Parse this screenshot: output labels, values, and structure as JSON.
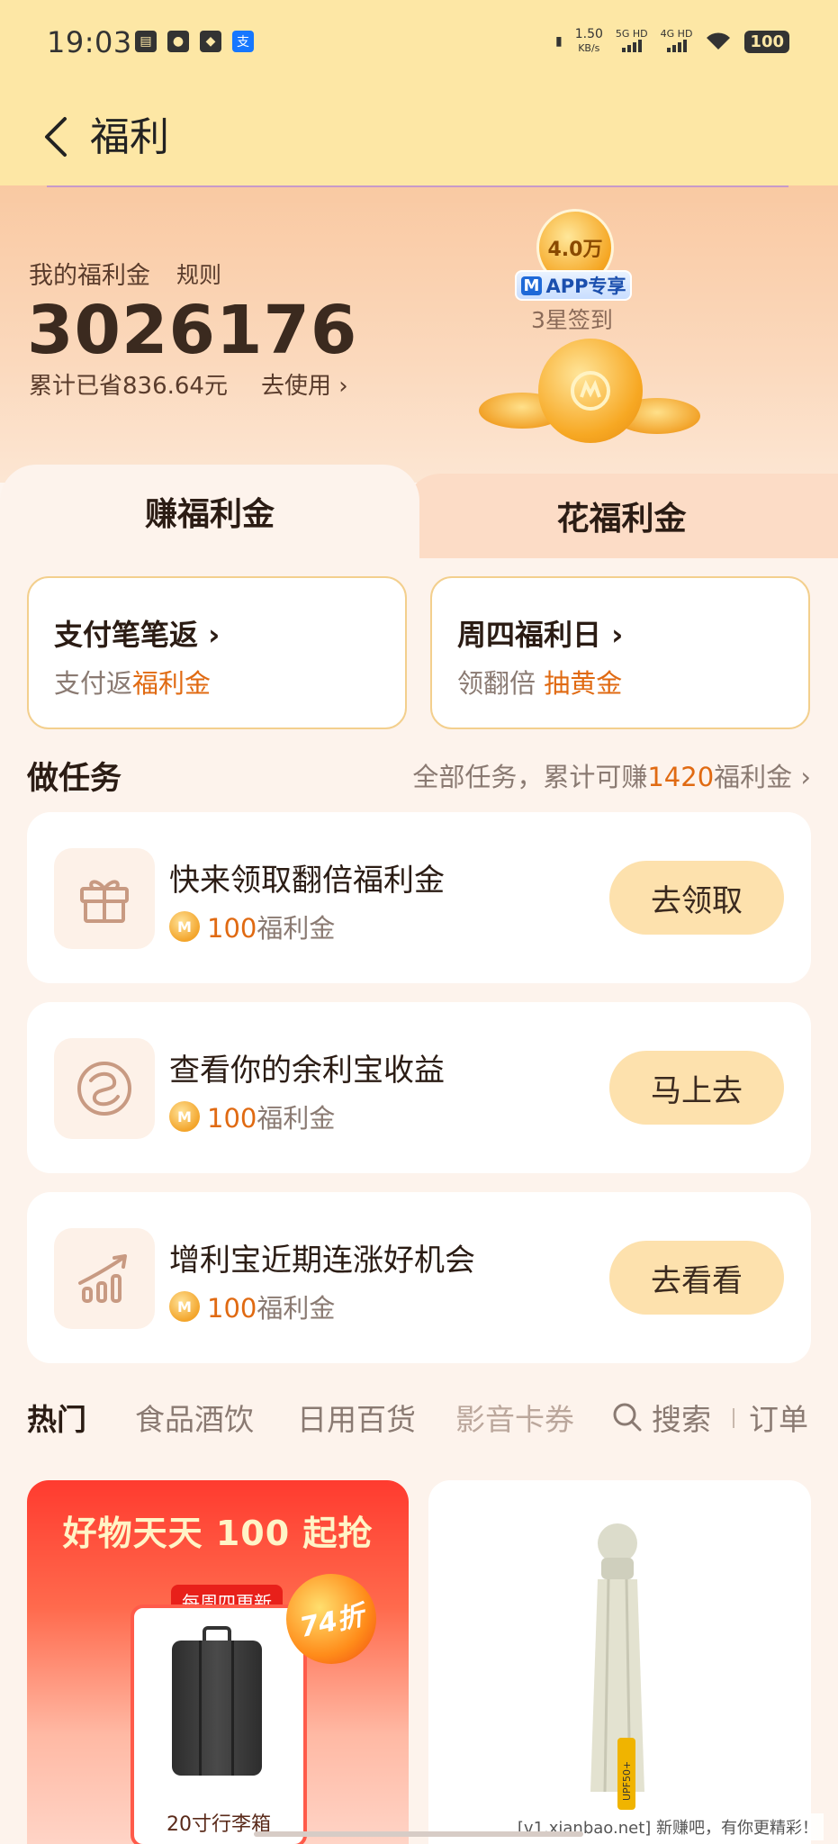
{
  "status_bar": {
    "time": "19:03",
    "speed": "1.50",
    "speed_unit": "KB/s",
    "net1": "5G HD",
    "net2": "4G HD",
    "battery": "100"
  },
  "nav": {
    "title": "福利"
  },
  "wallet": {
    "label": "我的福利金",
    "rules": "规则",
    "balance": "3026176",
    "saved": "累计已省836.64元",
    "use_link": "去使用",
    "promo_amount": "4.0万",
    "app_badge_m": "M",
    "app_badge": "APP专享",
    "checkin": "3星签到"
  },
  "tabs": {
    "earn": "赚福利金",
    "spend": "花福利金"
  },
  "promos": [
    {
      "title": "支付笔笔返",
      "sub_plain": "支付返",
      "sub_highlight": "福利金"
    },
    {
      "title": "周四福利日",
      "sub_plain": "领翻倍 ",
      "sub_highlight": "抽黄金"
    }
  ],
  "tasks_section": {
    "title": "做任务",
    "more_prefix": "全部任务，累计可赚",
    "more_num": "1420",
    "more_suffix": "福利金"
  },
  "tasks": [
    {
      "title": "快来领取翻倍福利金",
      "reward_amount": "100",
      "reward_unit": "福利金",
      "button": "去领取",
      "icon": "gift-icon"
    },
    {
      "title": "查看你的余利宝收益",
      "reward_amount": "100",
      "reward_unit": "福利金",
      "button": "马上去",
      "icon": "yulibao-icon"
    },
    {
      "title": "增利宝近期连涨好机会",
      "reward_amount": "100",
      "reward_unit": "福利金",
      "button": "去看看",
      "icon": "growth-chart-icon"
    }
  ],
  "categories": {
    "items": [
      "热门",
      "食品酒饮",
      "日用百货",
      "影音卡券"
    ],
    "search": "搜索",
    "orders": "订单"
  },
  "products": {
    "left_banner": "好物天天 100 起抢",
    "left_tag": "每周四更新",
    "left_caption": "20寸行李箱",
    "left_discount": "74折",
    "right_label": "UPF50+"
  },
  "watermark": "[v1.xianbao.net] 新赚吧，有你更精彩！",
  "colors": {
    "accent_orange": "#e06a12",
    "header_yellow": "#fde7a5",
    "button_bg": "#fde1ad"
  }
}
